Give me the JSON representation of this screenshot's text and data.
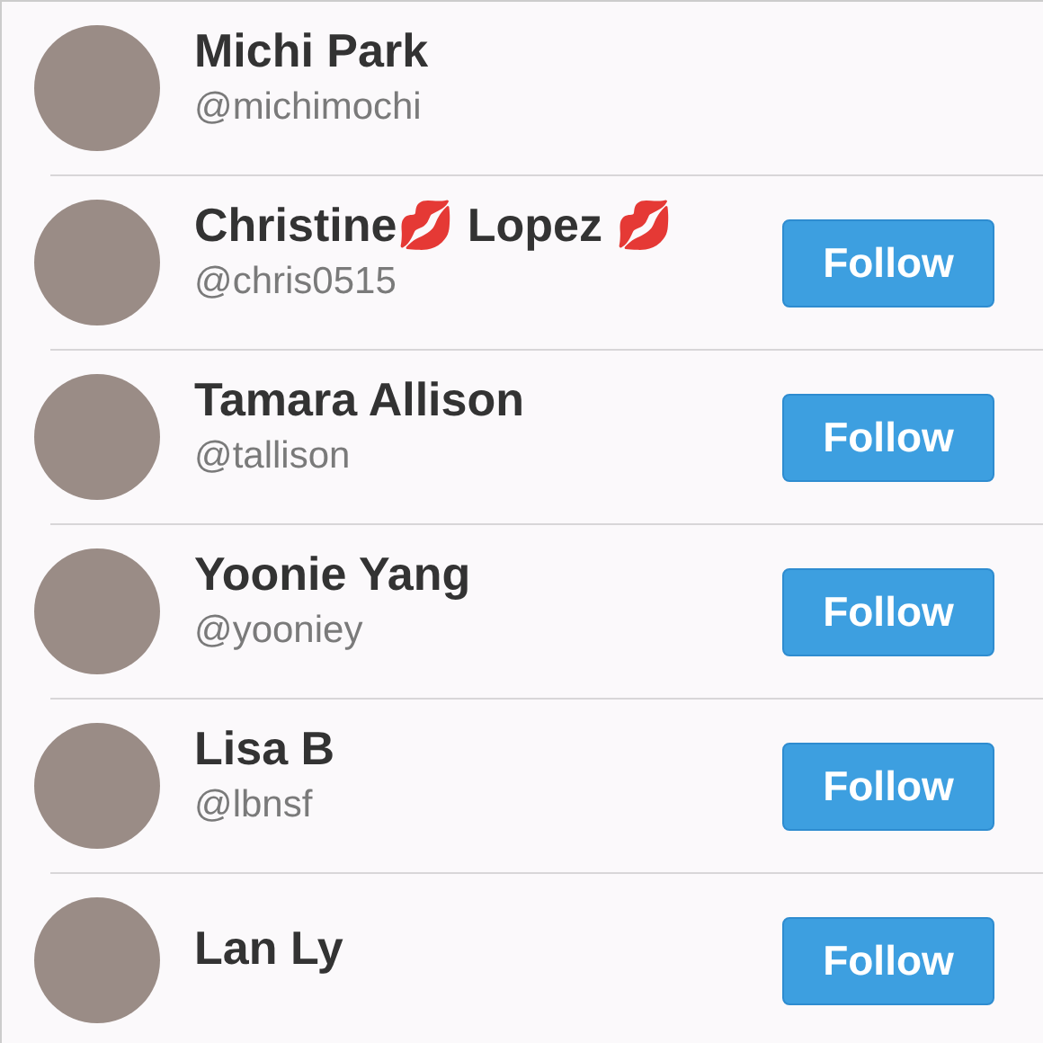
{
  "users": [
    {
      "name": "Michi Park",
      "handle": "@michimochi"
    },
    {
      "name": "Christine💋 Lopez 💋",
      "handle": "@chris0515",
      "button": "Follow"
    },
    {
      "name": "Tamara Allison",
      "handle": "@tallison",
      "button": "Follow"
    },
    {
      "name": "Yoonie Yang",
      "handle": "@yooniey",
      "button": "Follow"
    },
    {
      "name": "Lisa B",
      "handle": "@lbnsf",
      "button": "Follow"
    },
    {
      "name": "Lan Ly",
      "button": "Follow"
    }
  ]
}
